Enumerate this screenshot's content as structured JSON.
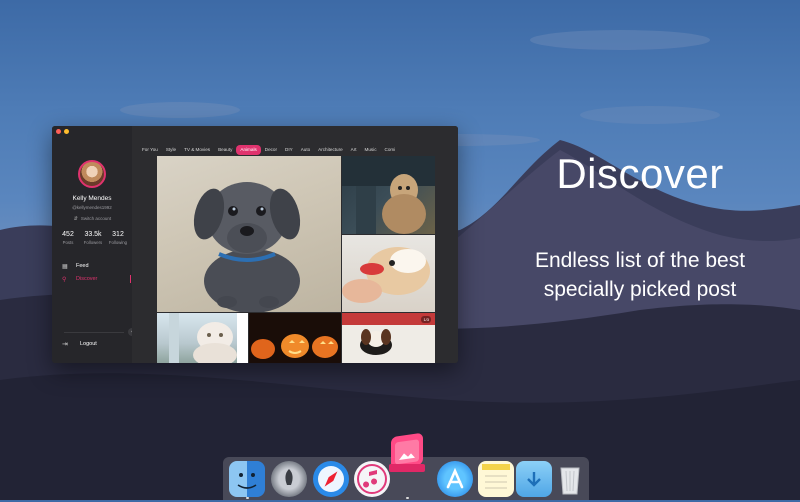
{
  "promo": {
    "title": "Discover",
    "subtitle_line1": "Endless list of the best",
    "subtitle_line2": "specially picked post"
  },
  "window": {
    "traffic_lights": [
      "#ff5f57",
      "#ffbd2e",
      "#28c940"
    ]
  },
  "profile": {
    "name": "Kelly Mendes",
    "handle": "@kellymendes1992",
    "switch_account": "Switch account",
    "stats": [
      {
        "value": "452",
        "label": "Posts"
      },
      {
        "value": "33.5k",
        "label": "Followers"
      },
      {
        "value": "312",
        "label": "Following"
      }
    ]
  },
  "nav": {
    "feed": "Feed",
    "discover": "Discover",
    "logout": "Logout",
    "active": "Discover"
  },
  "tabs": [
    "For You",
    "Style",
    "TV & Movies",
    "Beauty",
    "Animals",
    "Decor",
    "DIY",
    "Auto",
    "Architecture",
    "Art",
    "Music",
    "Comi"
  ],
  "active_tab": "Animals",
  "grid": {
    "badge": "1/3",
    "tiles": [
      "puppy",
      "dog in car",
      "guinea pig",
      "cat",
      "pumpkins",
      "dog on blanket"
    ]
  },
  "dock": {
    "apps": [
      "finder-icon",
      "launchpad-icon",
      "safari-icon",
      "itunes-icon",
      "app-store-icon",
      "notes-icon",
      "downloads-folder-icon",
      "trash-icon"
    ],
    "featured_app": "app-icon-featured"
  },
  "colors": {
    "accent": "#e0336e",
    "window_bg": "#2c2c2f",
    "sidebar_bg": "#26262a"
  }
}
